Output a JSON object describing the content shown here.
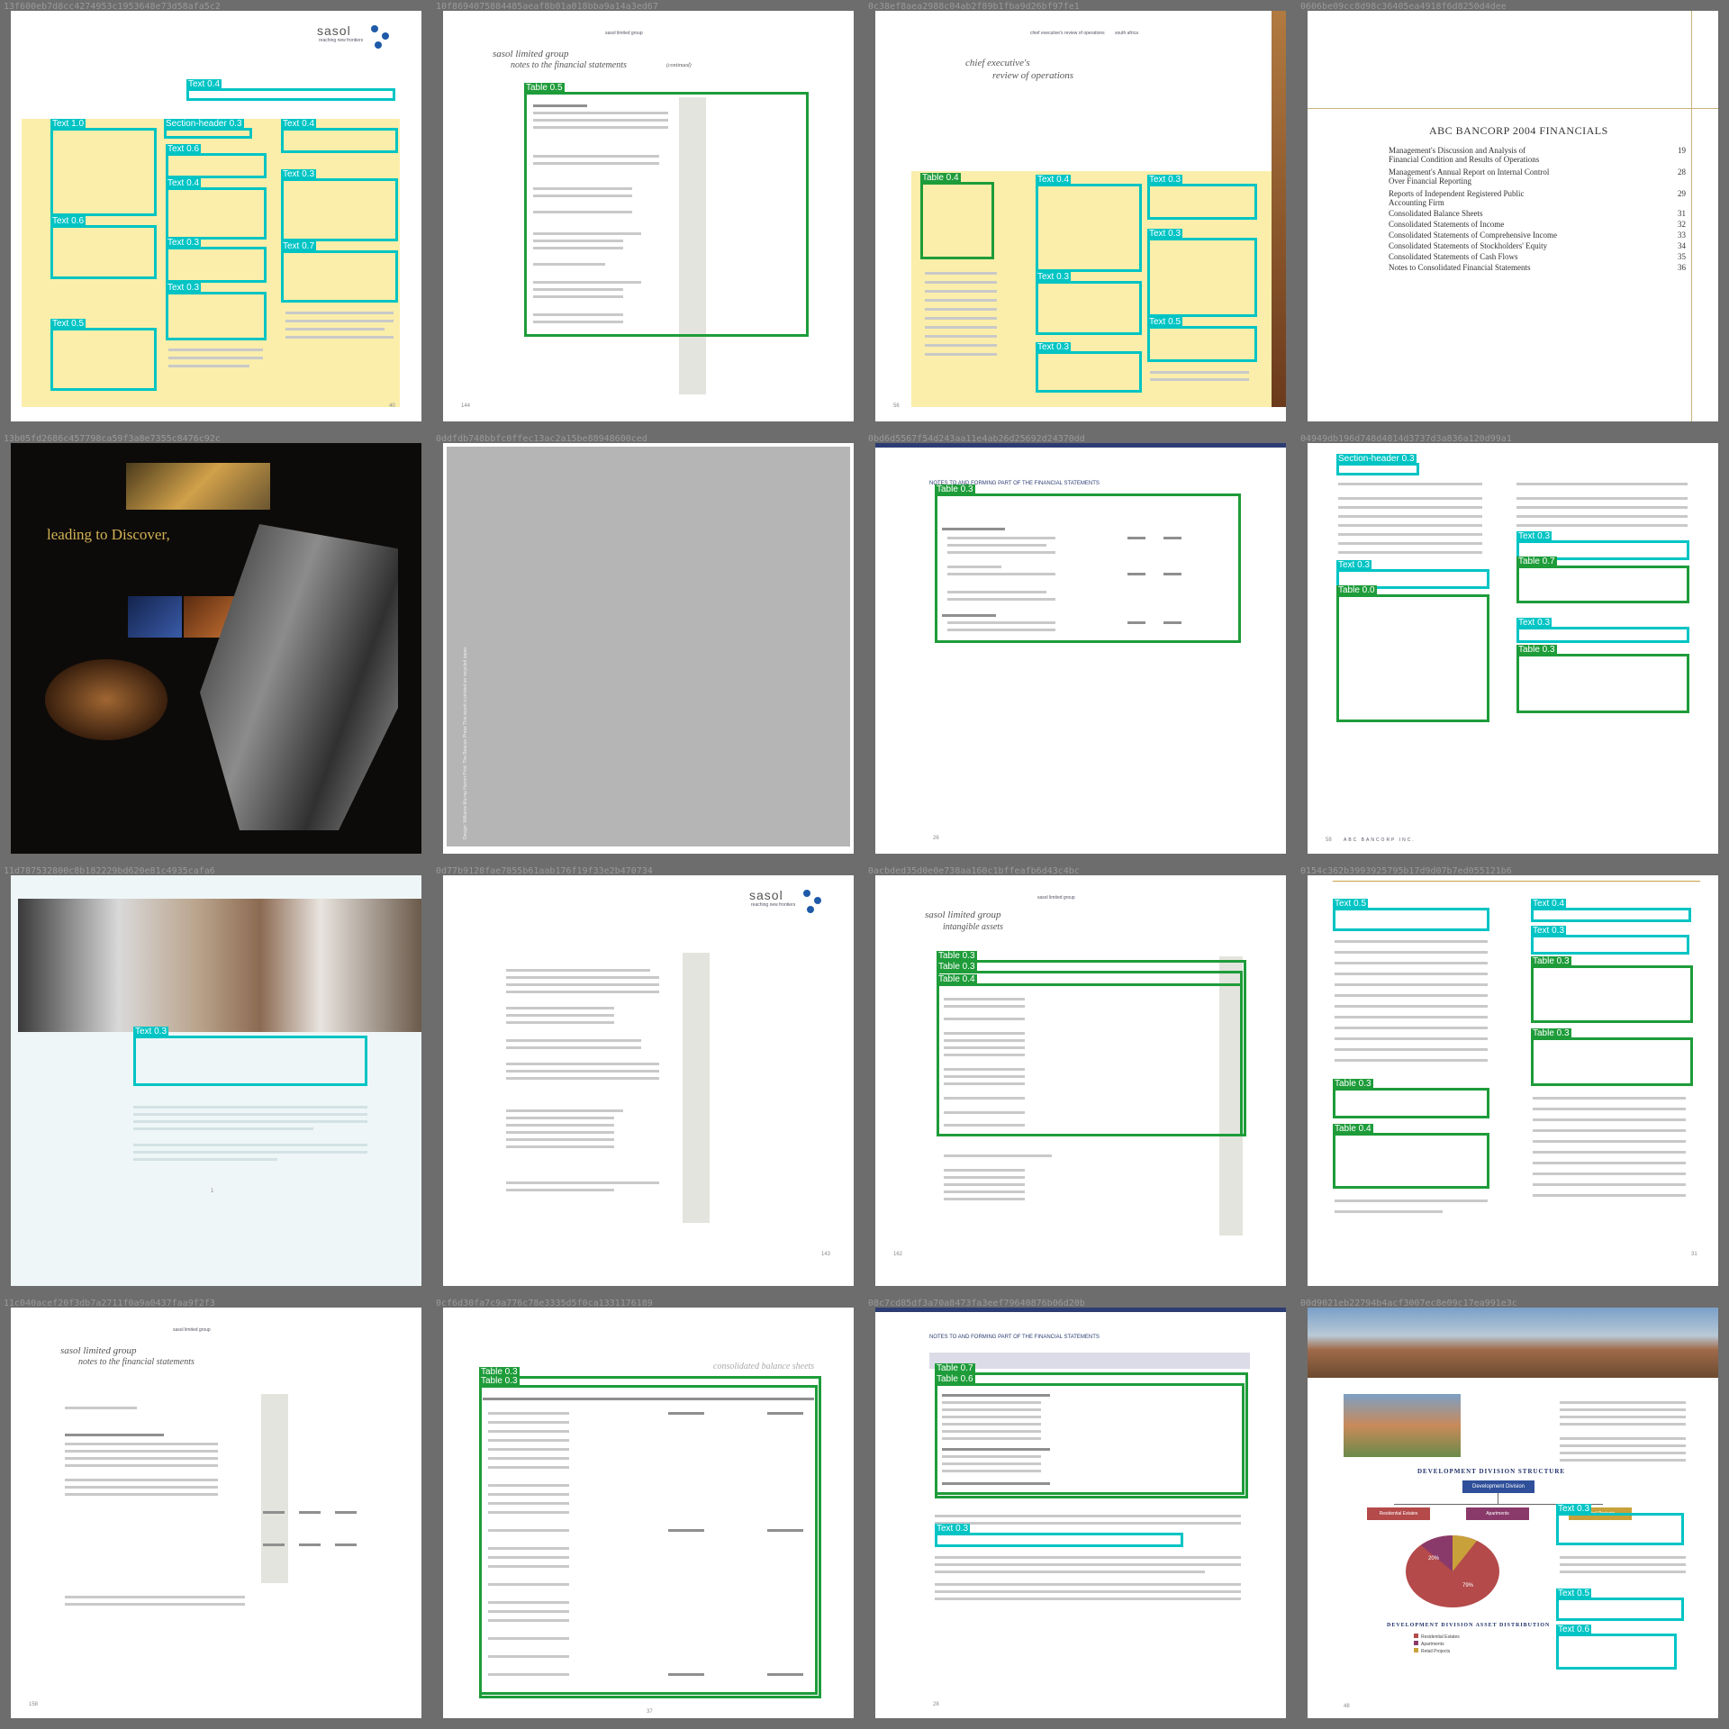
{
  "tiles": [
    {
      "id": "13f600eb7d8cc4274953c1953648e73d58afa5c2",
      "logo_text": "sasol",
      "logo_tagline": "reaching new frontiers",
      "page_number": "40",
      "labels": [
        "Text 0.4",
        "Text 1.0",
        "Section-header 0.3",
        "Text 0.4",
        "Text 0.6",
        "Text 0.4",
        "Text 0.3",
        "Text 0.6",
        "Text 0.3",
        "Text 0.7",
        "Text 0.3",
        "Text 0.5"
      ]
    },
    {
      "id": "10f8694075884485aeaf8b01a018bba9a14a3ed67",
      "running_head": "sasol limited group",
      "company": "sasol limited group",
      "subtitle": "notes to the financial statements",
      "continued": "(continued)",
      "page_number": "144",
      "labels": [
        "Table 0.5"
      ]
    },
    {
      "id": "0c38ef8aea2988c04ab2f89b1fba9d26bf97fe1",
      "running_head": "chief executive's review of operations",
      "running_head_suffix": "south africa",
      "title_line1": "chief executive's",
      "title_line2": "review of operations",
      "page_number": "56",
      "labels": [
        "Table 0.4",
        "Text 0.4",
        "Text 0.3",
        "Text 0.3",
        "Text 0.3",
        "Text 0.5",
        "Text 0.3"
      ]
    },
    {
      "id": "0606be09cc8d98c36405ea4918f6d8250d4dee",
      "title": "ABC BANCORP 2004 FINANCIALS",
      "toc": [
        {
          "title": "Management's Discussion and Analysis of",
          "title2": "Financial Condition and Results of Operations",
          "page": "19"
        },
        {
          "title": "Management's Annual Report on Internal Control",
          "title2": "Over Financial Reporting",
          "page": "28"
        },
        {
          "title": "Reports of Independent Registered Public",
          "title2": "Accounting Firm",
          "page": "29"
        },
        {
          "title": "Consolidated Balance Sheets",
          "title2": "",
          "page": "31"
        },
        {
          "title": "Consolidated Statements of Income",
          "title2": "",
          "page": "32"
        },
        {
          "title": "Consolidated Statements of Comprehensive Income",
          "title2": "",
          "page": "33"
        },
        {
          "title": "Consolidated Statements of Stockholders' Equity",
          "title2": "",
          "page": "34"
        },
        {
          "title": "Consolidated Statements of Cash Flows",
          "title2": "",
          "page": "35"
        },
        {
          "title": "Notes to Consolidated Financial Statements",
          "title2": "",
          "page": "36"
        }
      ]
    },
    {
      "id": "13b05fd2686c457798ca59f3a8e7355c8476c92c",
      "tagline": "leading to Discover,"
    },
    {
      "id": "0ddfdb748bbfc0ffec13ac2a15be88948600ced",
      "vertical_text": "Design: Williams Murray Hamm Print: The Beacon Press This report is printed on recycled paper"
    },
    {
      "id": "0bd6d5567f54d243aa11e4ab26d25692d24370dd",
      "running_title": "NOTES TO AND FORMING PART OF THE FINANCIAL STATEMENTS",
      "page_number": "26",
      "labels": [
        "Table 0.3"
      ]
    },
    {
      "id": "04949db196d748d4814d3737d3a836a120d99a1",
      "footer": "ABC BANCORP INC.",
      "page_number": "58",
      "labels": [
        "Section-header 0.3",
        "Text 0.3",
        "Table 0.7",
        "Text 0.3",
        "Table 0.0",
        "Text 0.3",
        "Table 0.3"
      ]
    },
    {
      "id": "11d787532800c8b182229bd620e81c4935cafa6",
      "page_number": "1",
      "labels": [
        "Text 0.3"
      ]
    },
    {
      "id": "0d77b9128fae7855b61aab176f19f33e2b470734",
      "logo_text": "sasol",
      "logo_tagline": "reaching new frontiers",
      "page_number": "143"
    },
    {
      "id": "0acbded35d0e0e738aa160c1bffeafb6d43c4bc",
      "running_head": "sasol limited group",
      "company": "sasol limited group",
      "subtitle": "intangible assets",
      "page_number": "162",
      "labels": [
        "Table 0.3",
        "Table 0.3",
        "Table 0.4"
      ]
    },
    {
      "id": "0154c362b3993925795b17d9d07b7ed055121b6",
      "page_number": "31",
      "labels": [
        "Text 0.5",
        "Text 0.4",
        "Text 0.3",
        "Table 0.3",
        "Table 0.3",
        "Table 0.3",
        "Table 0.4"
      ]
    },
    {
      "id": "11c040acef20f3db7a2711f0a9a0437faa9f2f3",
      "running_head": "sasol limited group",
      "company": "sasol limited group",
      "subtitle": "notes to the financial statements",
      "continued": "(continued)",
      "page_number": "158"
    },
    {
      "id": "0cf6d30fa7c9a776c78e3335d5f0ca1331176189",
      "running_title": "consolidated balance sheets",
      "page_number": "37",
      "labels": [
        "Table 0.3",
        "Table 0.3"
      ]
    },
    {
      "id": "08c7cd85df3a70a8473fa3eef79640876b06d20b",
      "running_title": "NOTES TO AND FORMING PART OF THE FINANCIAL STATEMENTS",
      "page_number": "28",
      "labels": [
        "Table 0.7",
        "Table 0.6",
        "Text 0.3"
      ]
    },
    {
      "id": "00d9021eb22794b4acf3007ec8e09c17ea991e3c",
      "chart_title": "DEVELOPMENT DIVISION STRUCTURE",
      "division_box": "Development Division",
      "boxes": [
        "Residential Estates",
        "Apartments",
        "Retail Projects"
      ],
      "pie_title": "DEVELOPMENT DIVISION ASSET DISTRIBUTION",
      "pie_labels": [
        "20%",
        "79%"
      ],
      "legend": [
        "Residential Estates",
        "Apartments",
        "Retail Projects"
      ],
      "page_number": "48",
      "colors": {
        "box": "#2f4f9a",
        "residential": "#b44a4a",
        "apartments": "#8a3a6a",
        "retail": "#c9a13a"
      },
      "labels": [
        "Text 0.3",
        "Text 0.5",
        "Text 0.6"
      ]
    }
  ]
}
